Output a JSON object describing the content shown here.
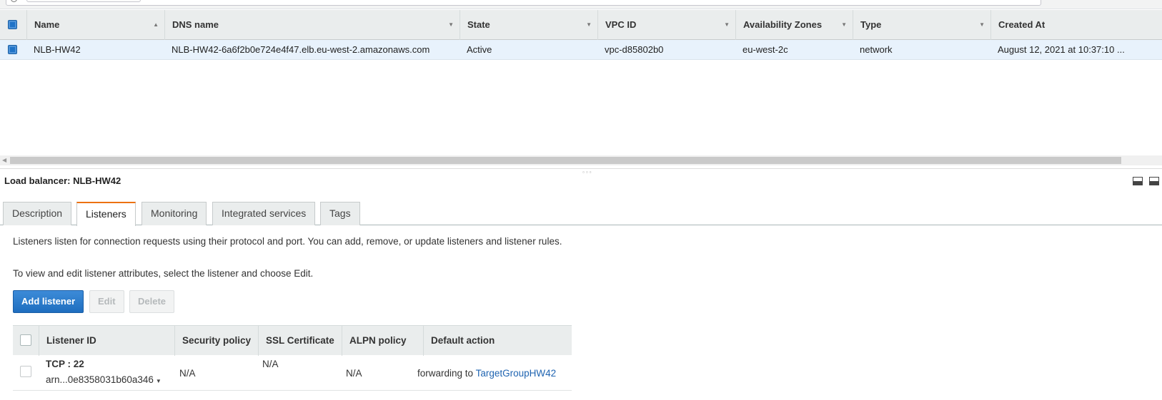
{
  "table": {
    "columns": [
      {
        "label": "Name",
        "sort": "▲"
      },
      {
        "label": "DNS name",
        "sort": "▼"
      },
      {
        "label": "State",
        "sort": "▼"
      },
      {
        "label": "VPC ID",
        "sort": "▼"
      },
      {
        "label": "Availability Zones",
        "sort": "▼"
      },
      {
        "label": "Type",
        "sort": "▼"
      },
      {
        "label": "Created At",
        "sort": ""
      }
    ],
    "rows": [
      {
        "name": "NLB-HW42",
        "dns": "NLB-HW42-6a6f2b0e724e4f47.elb.eu-west-2.amazonaws.com",
        "state": "Active",
        "vpc": "vpc-d85802b0",
        "az": "eu-west-2c",
        "type": "network",
        "created": "August 12, 2021 at 10:37:10 ..."
      }
    ]
  },
  "details": {
    "title": "Load balancer: NLB-HW42",
    "tabs": [
      "Description",
      "Listeners",
      "Monitoring",
      "Integrated services",
      "Tags"
    ],
    "active_tab": "Listeners",
    "intro": "Listeners listen for connection requests using their protocol and port. You can add, remove, or update listeners and listener rules.",
    "hint": "To view and edit listener attributes, select the listener and choose Edit.",
    "buttons": {
      "add": "Add listener",
      "edit": "Edit",
      "delete": "Delete"
    }
  },
  "listeners": {
    "columns": [
      "Listener ID",
      "Security policy",
      "SSL Certificate",
      "ALPN policy",
      "Default action"
    ],
    "rows": [
      {
        "id": "TCP : 22",
        "arn": "arn...0e8358031b60a346",
        "security_policy": "N/A",
        "ssl": "N/A",
        "alpn": "N/A",
        "action_prefix": "forwarding to",
        "action_target": "TargetGroupHW42"
      }
    ]
  },
  "colors": {
    "accent": "#ec7211",
    "primary": "#2174c7",
    "link": "#1f64b1",
    "selected_row": "#e8f2fc"
  }
}
